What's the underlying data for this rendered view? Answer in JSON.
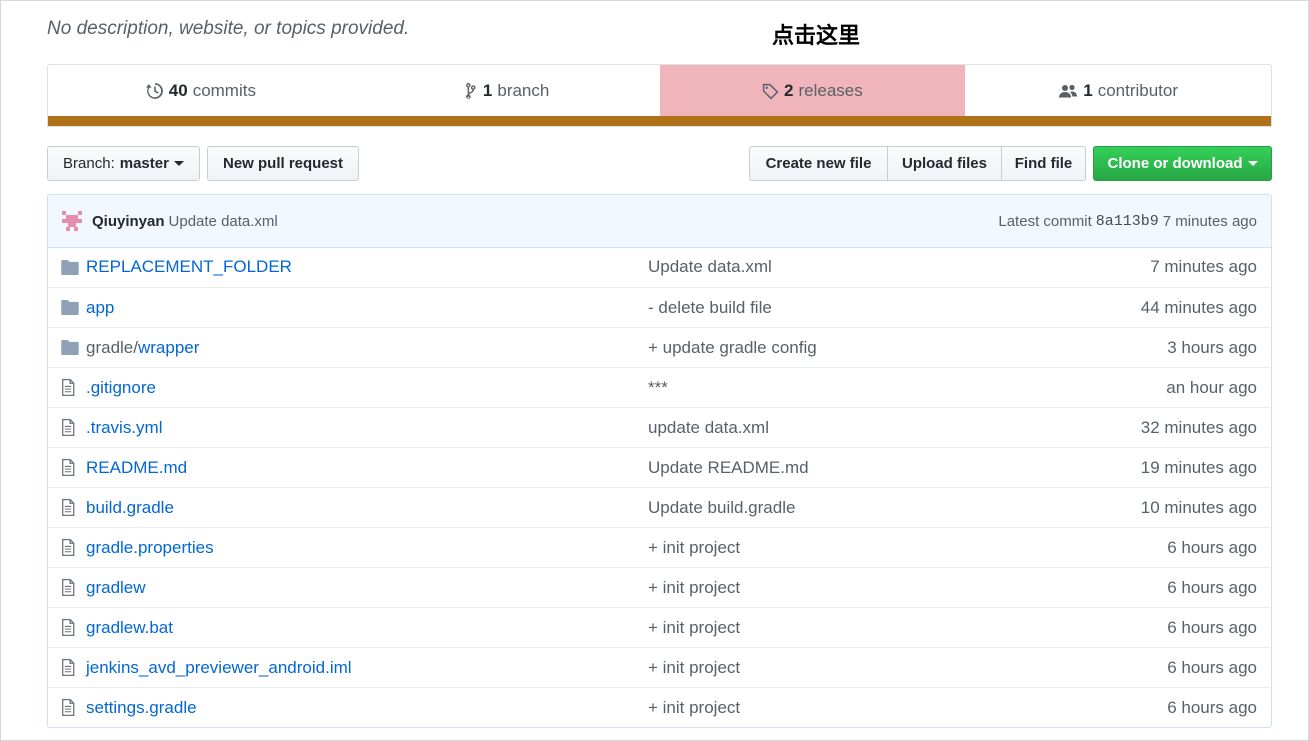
{
  "repo": {
    "description": "No description, website, or topics provided.",
    "annotation": "点击这里"
  },
  "numbers": {
    "commits": {
      "count": "40",
      "label": "commits"
    },
    "branches": {
      "count": "1",
      "label": "branch"
    },
    "releases": {
      "count": "2",
      "label": "releases"
    },
    "contributors": {
      "count": "1",
      "label": "contributor"
    }
  },
  "language_bar_color": "#b07219",
  "highlight_color": "#f0b5bb",
  "toolbar": {
    "branch_prefix": "Branch:",
    "branch_name": "master",
    "new_pull_request": "New pull request",
    "create_new_file": "Create new file",
    "upload_files": "Upload files",
    "find_file": "Find file",
    "clone_or_download": "Clone or download"
  },
  "latest_commit": {
    "author": "Qiuyinyan",
    "message": "Update data.xml",
    "label": "Latest commit",
    "sha": "8a113b9",
    "age": "7 minutes ago"
  },
  "files": [
    {
      "type": "folder",
      "name": "REPLACEMENT_FOLDER",
      "message": "Update data.xml",
      "age": "7 minutes ago"
    },
    {
      "type": "folder",
      "name": "app",
      "message": "- delete build file",
      "age": "44 minutes ago"
    },
    {
      "type": "folder",
      "name_prefix": "gradle/",
      "name": "wrapper",
      "message": "+ update gradle config",
      "age": "3 hours ago"
    },
    {
      "type": "file",
      "name": ".gitignore",
      "message": "***",
      "age": "an hour ago"
    },
    {
      "type": "file",
      "name": ".travis.yml",
      "message": "update data.xml",
      "age": "32 minutes ago"
    },
    {
      "type": "file",
      "name": "README.md",
      "message": "Update README.md",
      "age": "19 minutes ago"
    },
    {
      "type": "file",
      "name": "build.gradle",
      "message": "Update build.gradle",
      "age": "10 minutes ago"
    },
    {
      "type": "file",
      "name": "gradle.properties",
      "message": "+ init project",
      "age": "6 hours ago"
    },
    {
      "type": "file",
      "name": "gradlew",
      "message": "+ init project",
      "age": "6 hours ago"
    },
    {
      "type": "file",
      "name": "gradlew.bat",
      "message": "+ init project",
      "age": "6 hours ago"
    },
    {
      "type": "file",
      "name": "jenkins_avd_previewer_android.iml",
      "message": "+ init project",
      "age": "6 hours ago"
    },
    {
      "type": "file",
      "name": "settings.gradle",
      "message": "+ init project",
      "age": "6 hours ago"
    }
  ]
}
